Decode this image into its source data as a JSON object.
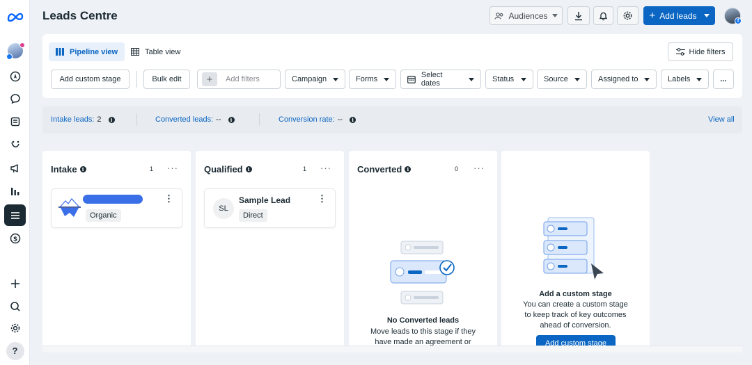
{
  "header": {
    "title": "Leads Centre",
    "audiences_label": "Audiences",
    "add_leads_label": "Add leads"
  },
  "views": {
    "pipeline_label": "Pipeline view",
    "table_label": "Table view",
    "hide_filters_label": "Hide filters"
  },
  "filters": {
    "add_custom_stage": "Add custom stage",
    "bulk_edit": "Bulk edit",
    "add_filters_placeholder": "Add filters",
    "campaign": "Campaign",
    "forms": "Forms",
    "select_dates": "Select dates",
    "status": "Status",
    "source": "Source",
    "assigned_to": "Assigned to",
    "labels": "Labels",
    "more": "..."
  },
  "stats": {
    "intake_label": "Intake leads:",
    "intake_value": "2",
    "converted_label": "Converted leads:",
    "converted_value": "--",
    "rate_label": "Conversion rate:",
    "rate_value": "--",
    "view_all": "View all"
  },
  "columns": [
    {
      "title": "Intake",
      "count": "1",
      "cards": [
        {
          "name": "",
          "tag": "Organic"
        }
      ]
    },
    {
      "title": "Qualified",
      "count": "1",
      "cards": [
        {
          "initials": "SL",
          "name": "Sample Lead",
          "tag": "Direct"
        }
      ]
    },
    {
      "title": "Converted",
      "count": "0",
      "empty_title": "No Converted leads",
      "empty_text_1": "Move leads to this stage if they",
      "empty_text_2": "have made an agreement or"
    }
  ],
  "custom_stage": {
    "title": "Add a custom stage",
    "text_1": "You can create a custom stage",
    "text_2": "to keep track of key outcomes",
    "text_3": "ahead of conversion.",
    "button": "Add custom stage"
  },
  "icons": {
    "brand": "meta-logo-icon",
    "help": "?"
  },
  "colors": {
    "accent": "#0a66c2",
    "dark": "#1c2b33",
    "intake_bar": "#3b6fe8"
  }
}
